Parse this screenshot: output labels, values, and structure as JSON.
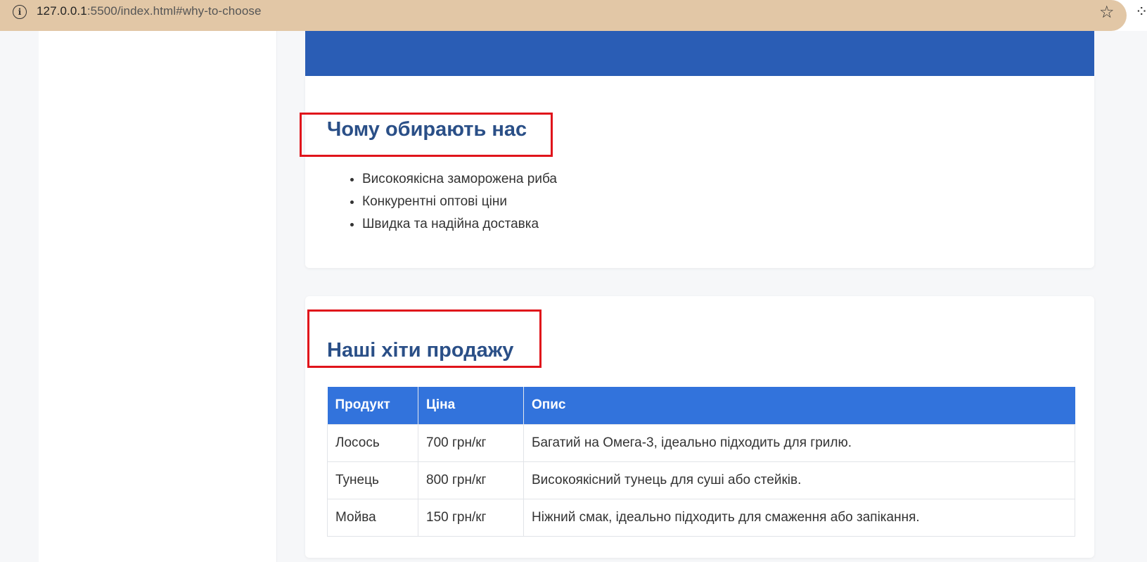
{
  "browser": {
    "url_host": "127.0.0.1",
    "url_rest": ":5500/index.html#why-to-choose"
  },
  "why": {
    "title": "Чому обирають нас",
    "items": [
      "Високоякісна заморожена риба",
      "Конкурентні оптові ціни",
      "Швидка та надійна доставка"
    ]
  },
  "hits": {
    "title": "Наші хіти продажу",
    "headers": [
      "Продукт",
      "Ціна",
      "Опис"
    ],
    "rows": [
      [
        "Лосось",
        "700 грн/кг",
        "Багатий на Омега-3, ідеально підходить для грилю."
      ],
      [
        "Тунець",
        "800 грн/кг",
        "Високоякісний тунець для суші або стейків."
      ],
      [
        "Мойва",
        "150 грн/кг",
        "Ніжний смак, ідеально підходить для смаження або запікання."
      ]
    ]
  },
  "colors": {
    "hero": "#2a5db5",
    "heading": "#2a4f87",
    "table_header": "#3273dc",
    "annotation": "#e0141b",
    "omnibox": "#e2c7a6"
  }
}
